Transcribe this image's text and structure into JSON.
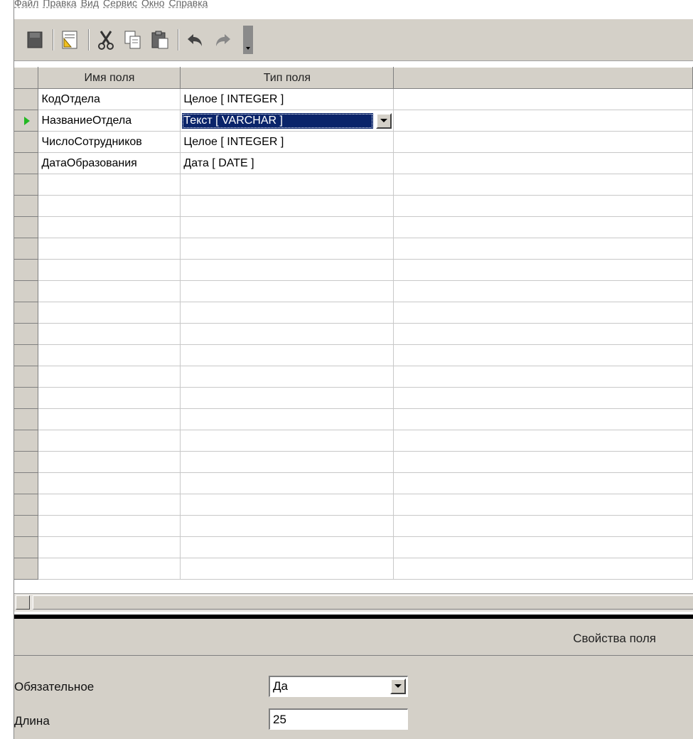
{
  "menu": [
    "Файл",
    "Правка",
    "Вид",
    "Сервис",
    "Окно",
    "Справка"
  ],
  "toolbar": {
    "icons": [
      "save-icon",
      "edit-icon",
      "cut-icon",
      "copy-icon",
      "paste-icon",
      "undo-icon",
      "redo-icon"
    ]
  },
  "grid": {
    "columns": [
      "Имя поля",
      "Тип поля",
      ""
    ],
    "rows": [
      {
        "name": "КодОтдела",
        "type": "Целое [ INTEGER ]"
      },
      {
        "name": "НазваниеОтдела",
        "type": "Текст [ VARCHAR ]"
      },
      {
        "name": "ЧислоСотрудников",
        "type": "Целое [ INTEGER ]"
      },
      {
        "name": "ДатаОбразования",
        "type": "Дата [ DATE ]"
      }
    ]
  },
  "properties": {
    "title": "Свойства поля",
    "required_label": "Обязательное",
    "required_value": "Да",
    "length_label": "Длина",
    "length_value": "25"
  },
  "colors": {
    "selection": "#0a246a",
    "panel": "#d4d0c8",
    "row_marker": "#22b822"
  }
}
